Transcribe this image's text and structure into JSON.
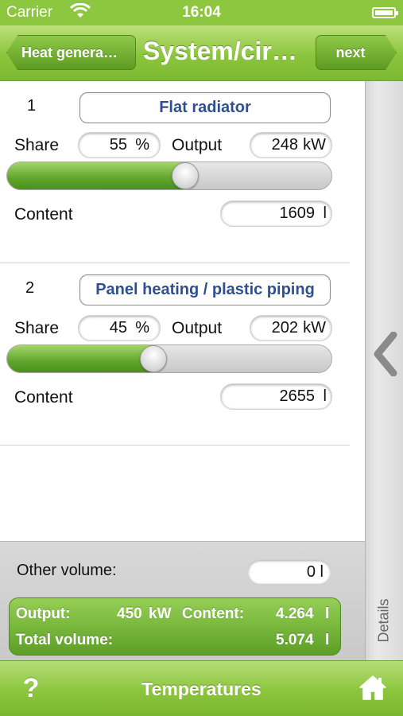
{
  "status_bar": {
    "carrier": "Carrier",
    "time": "16:04"
  },
  "nav": {
    "back_label": "Heat genera…",
    "title": "System/cir…",
    "next_label": "next"
  },
  "circuits": [
    {
      "number": "1",
      "type": "Flat radiator",
      "share_label": "Share",
      "share_value": "55",
      "share_unit": "%",
      "output_label": "Output",
      "output_value": "248",
      "output_unit": "kW",
      "content_label": "Content",
      "content_value": "1609",
      "content_unit": "l",
      "share_fraction": 0.55
    },
    {
      "number": "2",
      "type": "Panel heating / plastic piping",
      "share_label": "Share",
      "share_value": "45",
      "share_unit": "%",
      "output_label": "Output",
      "output_value": "202",
      "output_unit": "kW",
      "content_label": "Content",
      "content_value": "2655",
      "content_unit": "l",
      "share_fraction": 0.45
    }
  ],
  "other_volume": {
    "label": "Other volume:",
    "value": "0",
    "unit": "l"
  },
  "totals": {
    "output_label": "Output:",
    "output_value": "450",
    "output_unit": "kW",
    "content_label": "Content:",
    "content_value": "4.264",
    "content_unit": "l",
    "total_label": "Total volume:",
    "total_value": "5.074",
    "total_unit": "l"
  },
  "details": {
    "label": "Details"
  },
  "toolbar": {
    "help": "?",
    "title": "Temperatures"
  },
  "colors": {
    "accent_green": "#8bc53d",
    "type_text": "#2f4f8f"
  }
}
